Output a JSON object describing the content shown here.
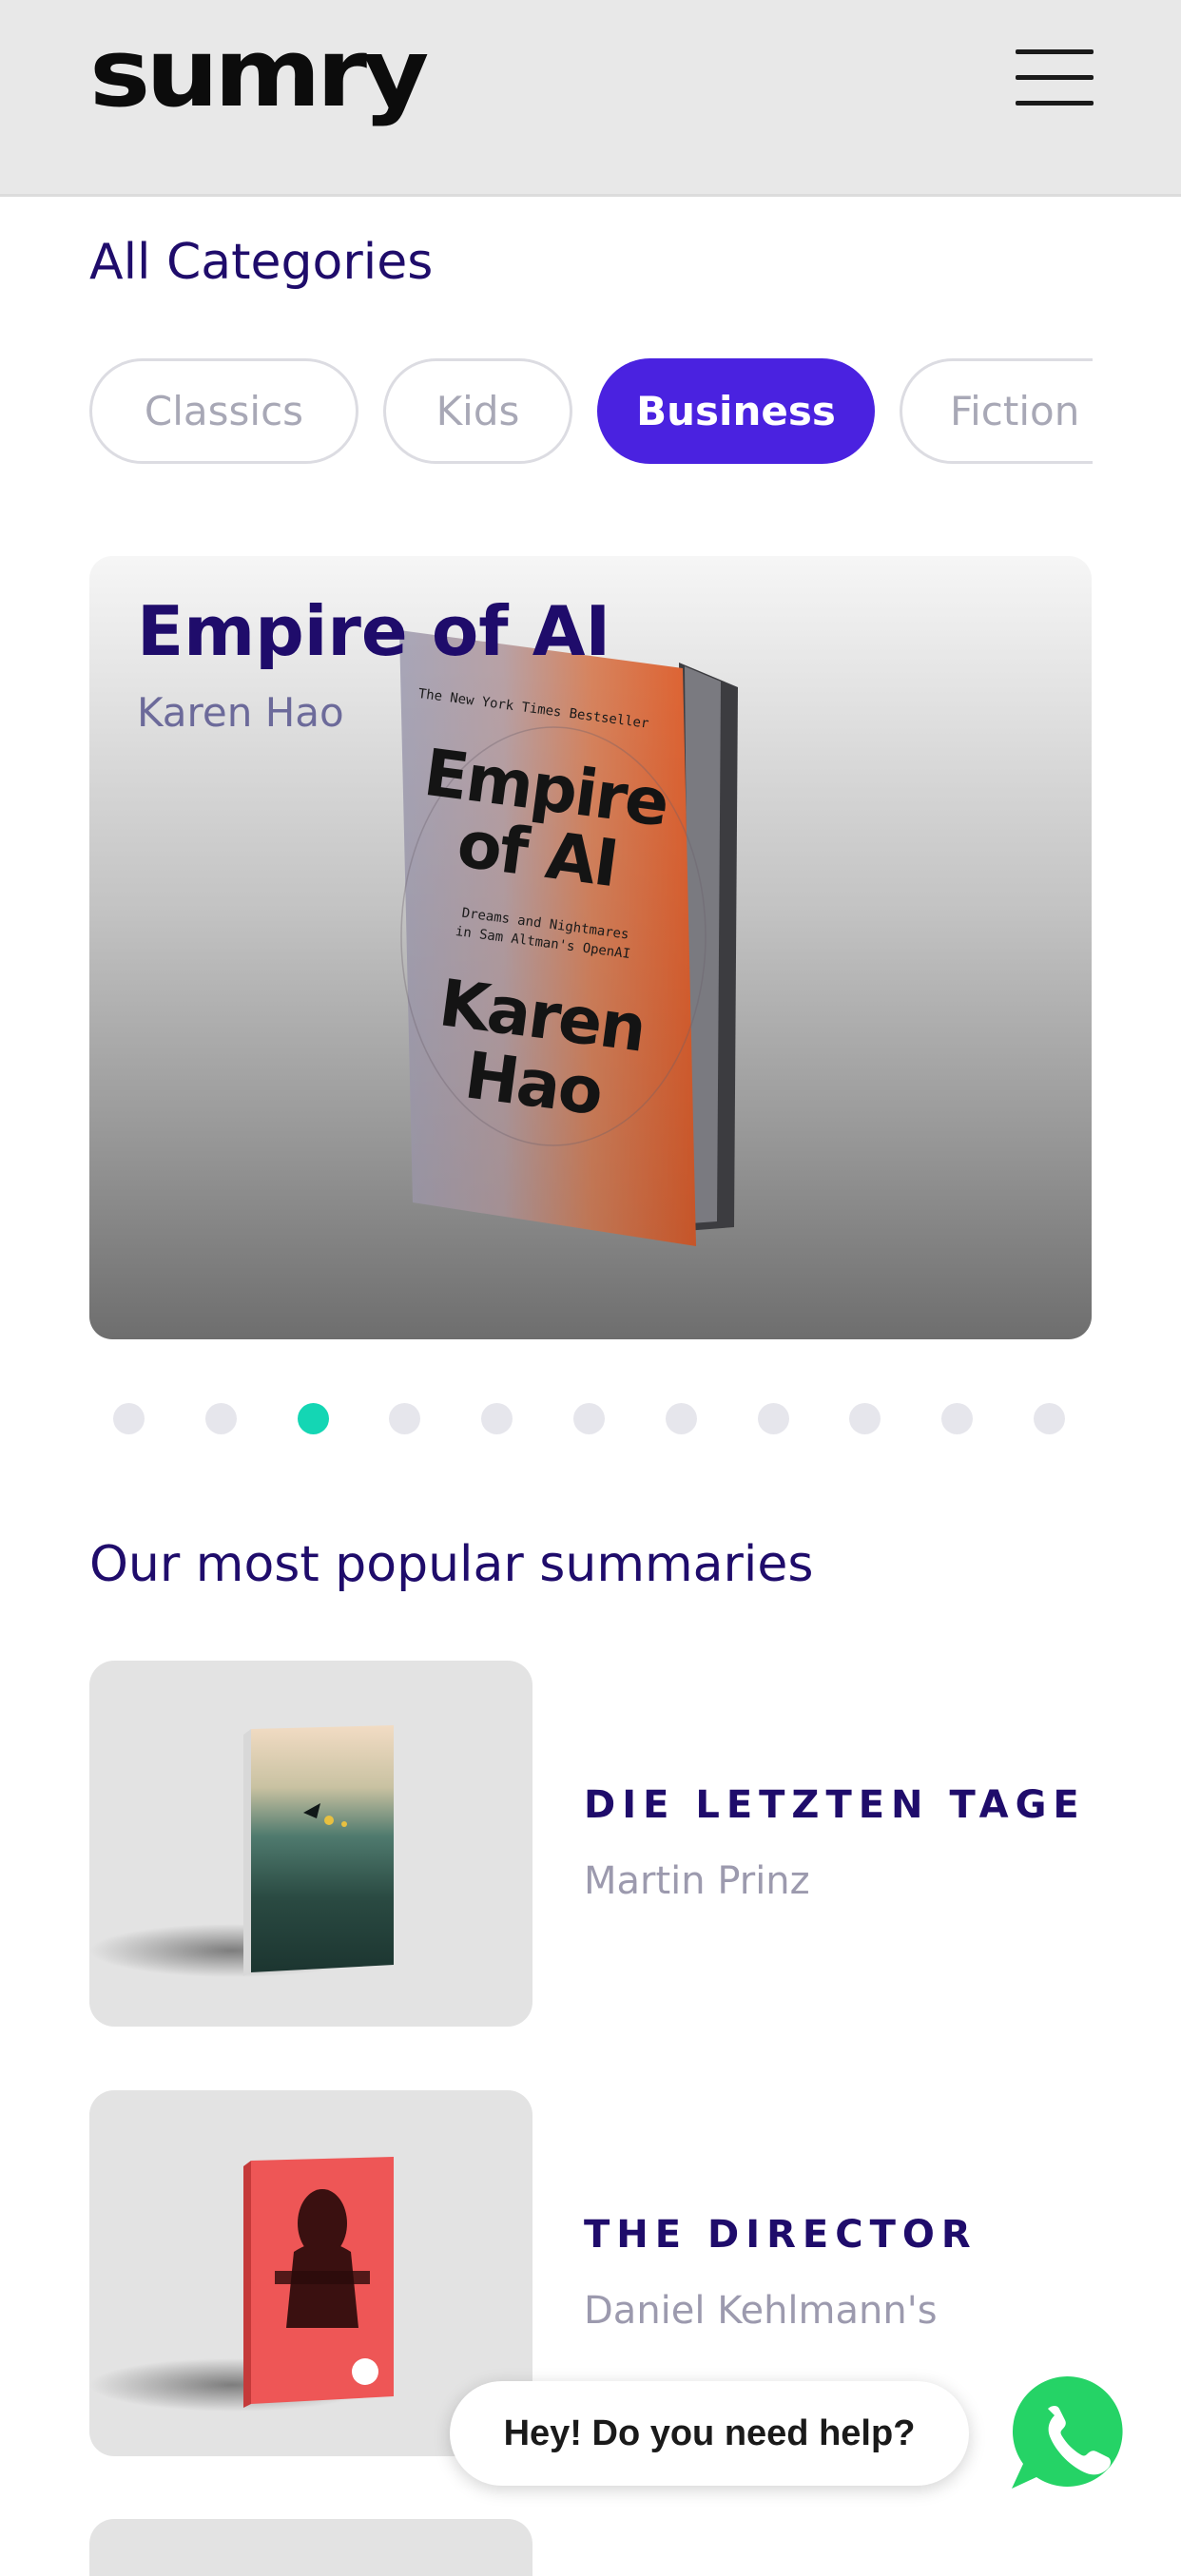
{
  "header": {
    "logo_text": "sumry",
    "menu_icon": "hamburger-menu-icon"
  },
  "categories": {
    "title": "All Categories",
    "items": [
      {
        "label": "Classics",
        "active": false
      },
      {
        "label": "Kids",
        "active": false
      },
      {
        "label": "Business",
        "active": true
      },
      {
        "label": "Fiction",
        "active": false
      }
    ]
  },
  "featured": {
    "title": "Empire of AI",
    "author": "Karen Hao",
    "cover": {
      "banner": "The New York Times Bestseller",
      "title_line1": "Empire",
      "title_line2": "of AI",
      "subtitle_line1": "Dreams and Nightmares",
      "subtitle_line2": "in Sam Altman's OpenAI",
      "author_line1": "Karen",
      "author_line2": "Hao"
    }
  },
  "carousel": {
    "total": 11,
    "active_index": 2,
    "active_color": "#14d6b4",
    "inactive_color": "#e6e6ec"
  },
  "popular": {
    "title": "Our most popular summaries",
    "items": [
      {
        "title": "DIE LETZTEN TAGE",
        "author": "Martin Prinz"
      },
      {
        "title": "THE DIRECTOR",
        "author": "Daniel Kehlmann's"
      }
    ]
  },
  "help": {
    "text": "Hey! Do you need help?",
    "icon": "whatsapp-icon"
  },
  "colors": {
    "accent": "#4a22e0",
    "heading": "#1f0c6b",
    "teal": "#14d6b4",
    "whatsapp": "#25d366"
  }
}
